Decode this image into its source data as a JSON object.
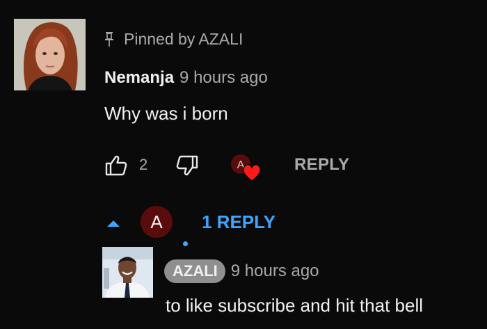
{
  "comment": {
    "pinned_text": "Pinned by AZALI",
    "author": "Nemanja",
    "time": "9 hours ago",
    "text": "Why was i born",
    "like_count": "2",
    "reply_label": "REPLY"
  },
  "replies": {
    "avatar_letter": "A",
    "toggle_label": "1 REPLY"
  },
  "reply": {
    "author": "AZALI",
    "time": "9 hours ago",
    "text": "to like subscribe and hit that bell"
  },
  "colors": {
    "background": "#0a0a0a",
    "accent_blue": "#3ea6ff",
    "heart_red": "#ff1a1a",
    "avatar_a_bg": "#5a0b0b"
  },
  "icons": {
    "pin": "pin-icon",
    "like": "thumbs-up-icon",
    "dislike": "thumbs-down-icon",
    "heart": "creator-heart-icon",
    "caret": "caret-up-icon"
  }
}
